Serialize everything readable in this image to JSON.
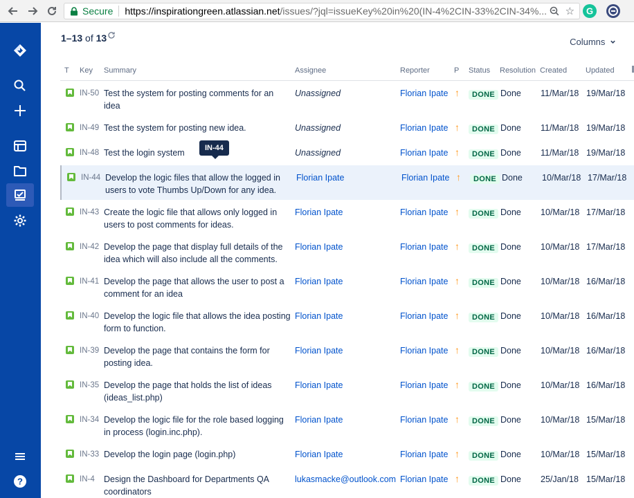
{
  "browser": {
    "secure_label": "Secure",
    "url_host": "https://inspirationgreen.atlassian.net",
    "url_rest": "/issues/?jql=issueKey%20in%20(IN-4%2CIN-33%2CIN-34%..."
  },
  "results": {
    "range": "1–13",
    "of": "of",
    "total": "13"
  },
  "columns_label": "Columns",
  "headers": {
    "t": "T",
    "key": "Key",
    "summary": "Summary",
    "assignee": "Assignee",
    "reporter": "Reporter",
    "p": "P",
    "status": "Status",
    "resolution": "Resolution",
    "created": "Created",
    "updated": "Updated"
  },
  "tooltip": "IN-44",
  "issues": [
    {
      "key": "IN-50",
      "summary": "Test the system for posting comments for an idea",
      "assignee": "Unassigned",
      "reporter": "Florian Ipate",
      "priority": "↑",
      "status": "DONE",
      "resolution": "Done",
      "created": "11/Mar/18",
      "updated": "19/Mar/18"
    },
    {
      "key": "IN-49",
      "summary": "Test the system for posting new idea.",
      "assignee": "Unassigned",
      "reporter": "Florian Ipate",
      "priority": "↑",
      "status": "DONE",
      "resolution": "Done",
      "created": "11/Mar/18",
      "updated": "19/Mar/18"
    },
    {
      "key": "IN-48",
      "summary": "Test the login system",
      "assignee": "Unassigned",
      "reporter": "Florian Ipate",
      "priority": "↑",
      "status": "DONE",
      "resolution": "Done",
      "created": "11/Mar/18",
      "updated": "19/Mar/18"
    },
    {
      "key": "IN-44",
      "summary": "Develop the logic files that allow the logged in users to vote Thumbs Up/Down for any idea.",
      "assignee": "Florian Ipate",
      "reporter": "Florian Ipate",
      "priority": "↑",
      "status": "DONE",
      "resolution": "Done",
      "created": "10/Mar/18",
      "updated": "17/Mar/18"
    },
    {
      "key": "IN-43",
      "summary": "Create the logic file that allows only logged in users to post comments for ideas.",
      "assignee": "Florian Ipate",
      "reporter": "Florian Ipate",
      "priority": "↑",
      "status": "DONE",
      "resolution": "Done",
      "created": "10/Mar/18",
      "updated": "17/Mar/18"
    },
    {
      "key": "IN-42",
      "summary": "Develop the page that display full details of the idea which will also include all the comments.",
      "assignee": "Florian Ipate",
      "reporter": "Florian Ipate",
      "priority": "↑",
      "status": "DONE",
      "resolution": "Done",
      "created": "10/Mar/18",
      "updated": "17/Mar/18"
    },
    {
      "key": "IN-41",
      "summary": "Develop the page that allows the user to post a comment for an idea",
      "assignee": "Florian Ipate",
      "reporter": "Florian Ipate",
      "priority": "↑",
      "status": "DONE",
      "resolution": "Done",
      "created": "10/Mar/18",
      "updated": "16/Mar/18"
    },
    {
      "key": "IN-40",
      "summary": "Develop the logic file that allows the idea posting form to function.",
      "assignee": "Florian Ipate",
      "reporter": "Florian Ipate",
      "priority": "↑",
      "status": "DONE",
      "resolution": "Done",
      "created": "10/Mar/18",
      "updated": "16/Mar/18"
    },
    {
      "key": "IN-39",
      "summary": "Develop the page that contains the form for posting idea.",
      "assignee": "Florian Ipate",
      "reporter": "Florian Ipate",
      "priority": "↑",
      "status": "DONE",
      "resolution": "Done",
      "created": "10/Mar/18",
      "updated": "16/Mar/18"
    },
    {
      "key": "IN-35",
      "summary": "Develop the page that holds the list of ideas (ideas_list.php)",
      "assignee": "Florian Ipate",
      "reporter": "Florian Ipate",
      "priority": "↑",
      "status": "DONE",
      "resolution": "Done",
      "created": "10/Mar/18",
      "updated": "16/Mar/18"
    },
    {
      "key": "IN-34",
      "summary": "Develop the logic file for the role based logging in process (login.inc.php).",
      "assignee": "Florian Ipate",
      "reporter": "Florian Ipate",
      "priority": "↑",
      "status": "DONE",
      "resolution": "Done",
      "created": "10/Mar/18",
      "updated": "15/Mar/18"
    },
    {
      "key": "IN-33",
      "summary": "Develop the login page (login.php)",
      "assignee": "Florian Ipate",
      "reporter": "Florian Ipate",
      "priority": "↑",
      "status": "DONE",
      "resolution": "Done",
      "created": "10/Mar/18",
      "updated": "15/Mar/18"
    },
    {
      "key": "IN-4",
      "summary": "Design the Dashboard for Departments QA coordinators",
      "assignee": "lukasmacke@outlook.com",
      "reporter": "Florian Ipate",
      "priority": "↑",
      "status": "DONE",
      "resolution": "Done",
      "created": "25/Jan/18",
      "updated": "15/Mar/18"
    }
  ],
  "colors": {
    "sidebar": "#0747a6",
    "link": "#0052cc",
    "done_bg": "#e3fcef",
    "done_fg": "#006644",
    "priority": "#ff991f",
    "story": "#63ba3c"
  }
}
